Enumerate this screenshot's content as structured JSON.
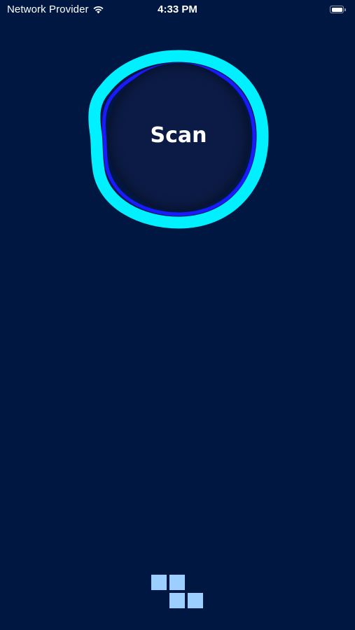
{
  "status_bar": {
    "carrier": "Network Provider",
    "time": "4:33 PM",
    "wifi_icon": "wifi-icon",
    "battery_icon": "battery-full-icon"
  },
  "scan": {
    "label": "Scan",
    "ring_color": "#00f0ff",
    "inner_ring_color": "#1a1aff",
    "button_color": "#0b1b45"
  },
  "footer": {
    "logo_icon": "tetromino-blocks-icon",
    "logo_color": "#9ccfff"
  },
  "theme": {
    "background": "#001741"
  }
}
